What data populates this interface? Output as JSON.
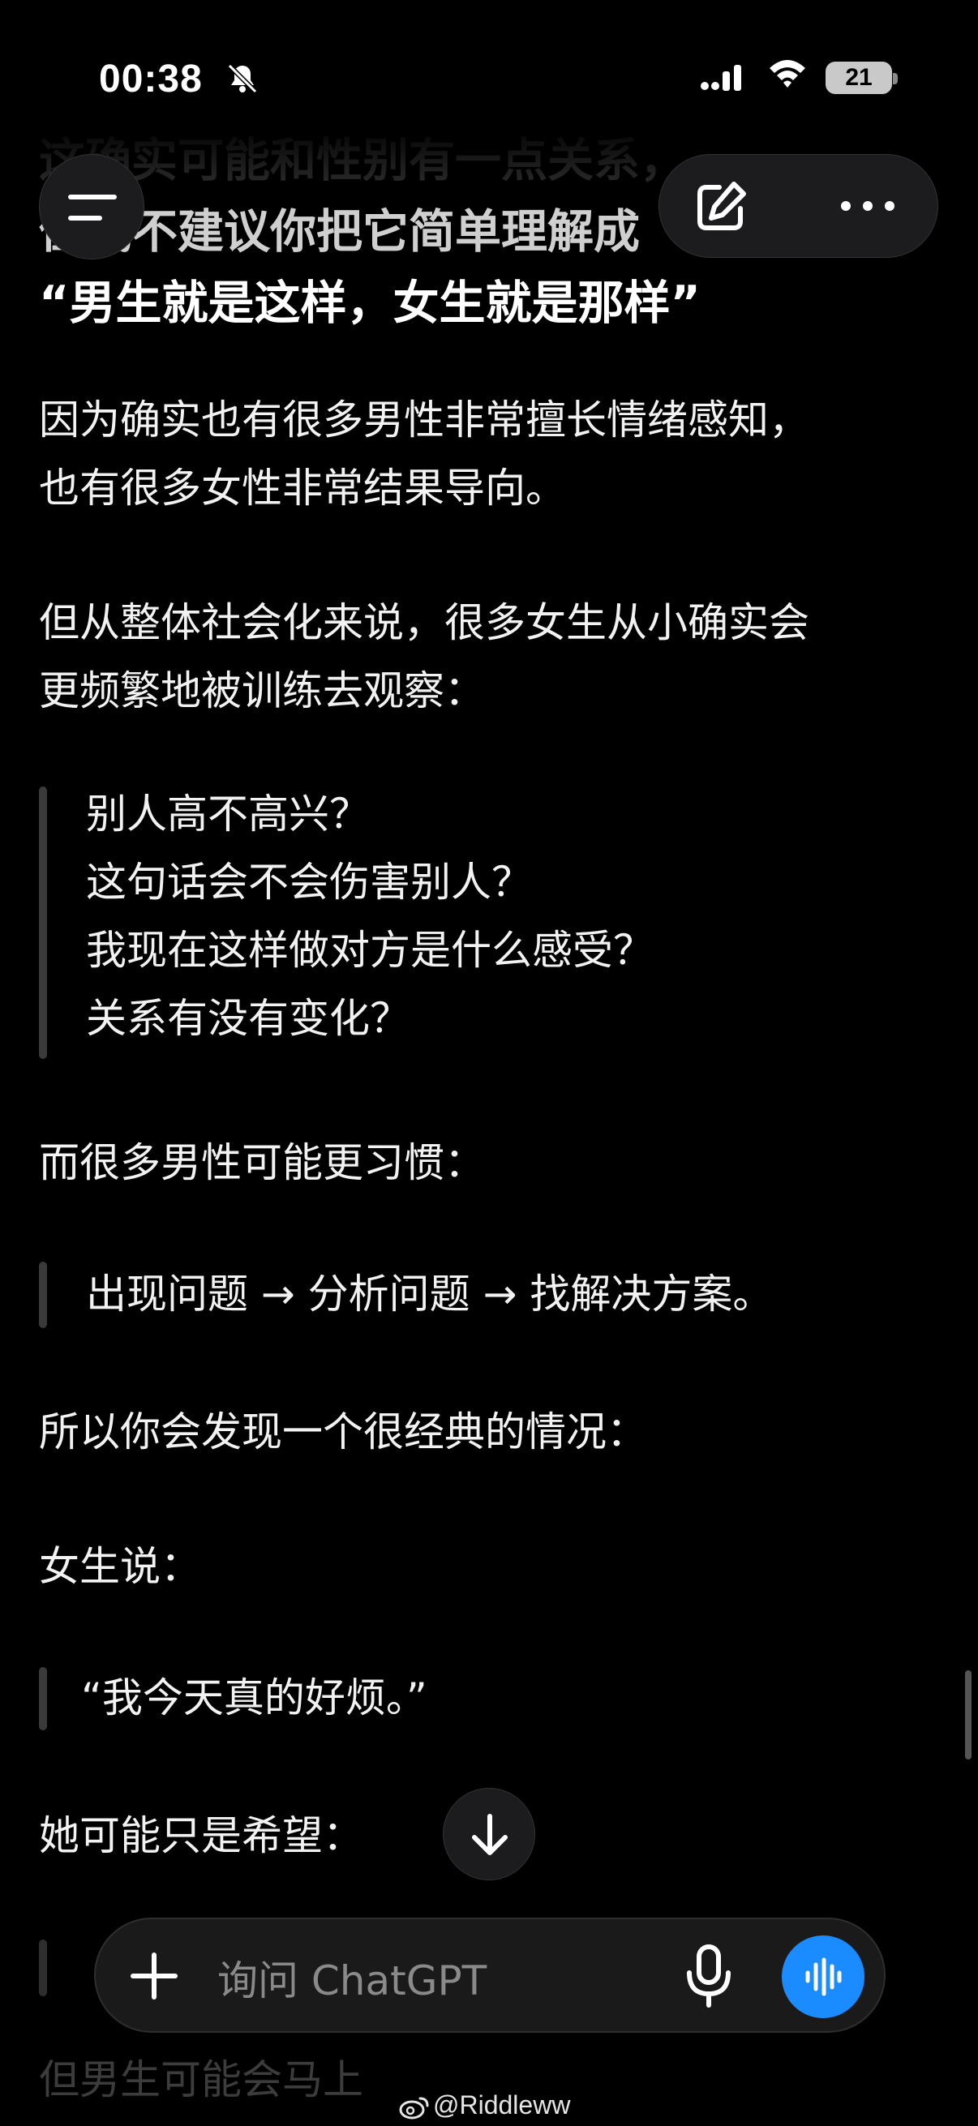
{
  "status_bar": {
    "time": "00:38",
    "battery": "21"
  },
  "headline": [
    "这确实可能和性别有一点关系，",
    "但我不建议你把它简单理解成",
    "“男生就是这样，女生就是那样”"
  ],
  "paragraphs": {
    "p1": [
      "因为确实也有很多男性非常擅长情绪感知，",
      "也有很多女性非常结果导向。"
    ],
    "p2": [
      "但从整体社会化来说，很多女生从小确实会",
      "更频繁地被训练去观察："
    ],
    "quote1": [
      "别人高不高兴？",
      "这句话会不会伤害别人？",
      "我现在这样做对方是什么感受？",
      "关系有没有变化？"
    ],
    "p3": "而很多男性可能更习惯：",
    "quote2": "出现问题 → 分析问题 → 找解决方案。",
    "p4": "所以你会发现一个很经典的情况：",
    "p5": "女生说：",
    "quote3": "“我今天真的好烦。”",
    "p6": "她可能只是希望：",
    "p7": "但男生可能会马上"
  },
  "composer": {
    "placeholder": "询问 ChatGPT"
  },
  "watermark": "@Riddleww",
  "icons": {
    "menu": "menu-icon",
    "edit": "edit-icon",
    "more": "more-icon",
    "down": "arrow-down-icon",
    "plus": "plus-icon",
    "mic": "mic-icon",
    "voice": "voice-wave-icon"
  },
  "colors": {
    "accent": "#1a8cff",
    "background": "#000000"
  }
}
